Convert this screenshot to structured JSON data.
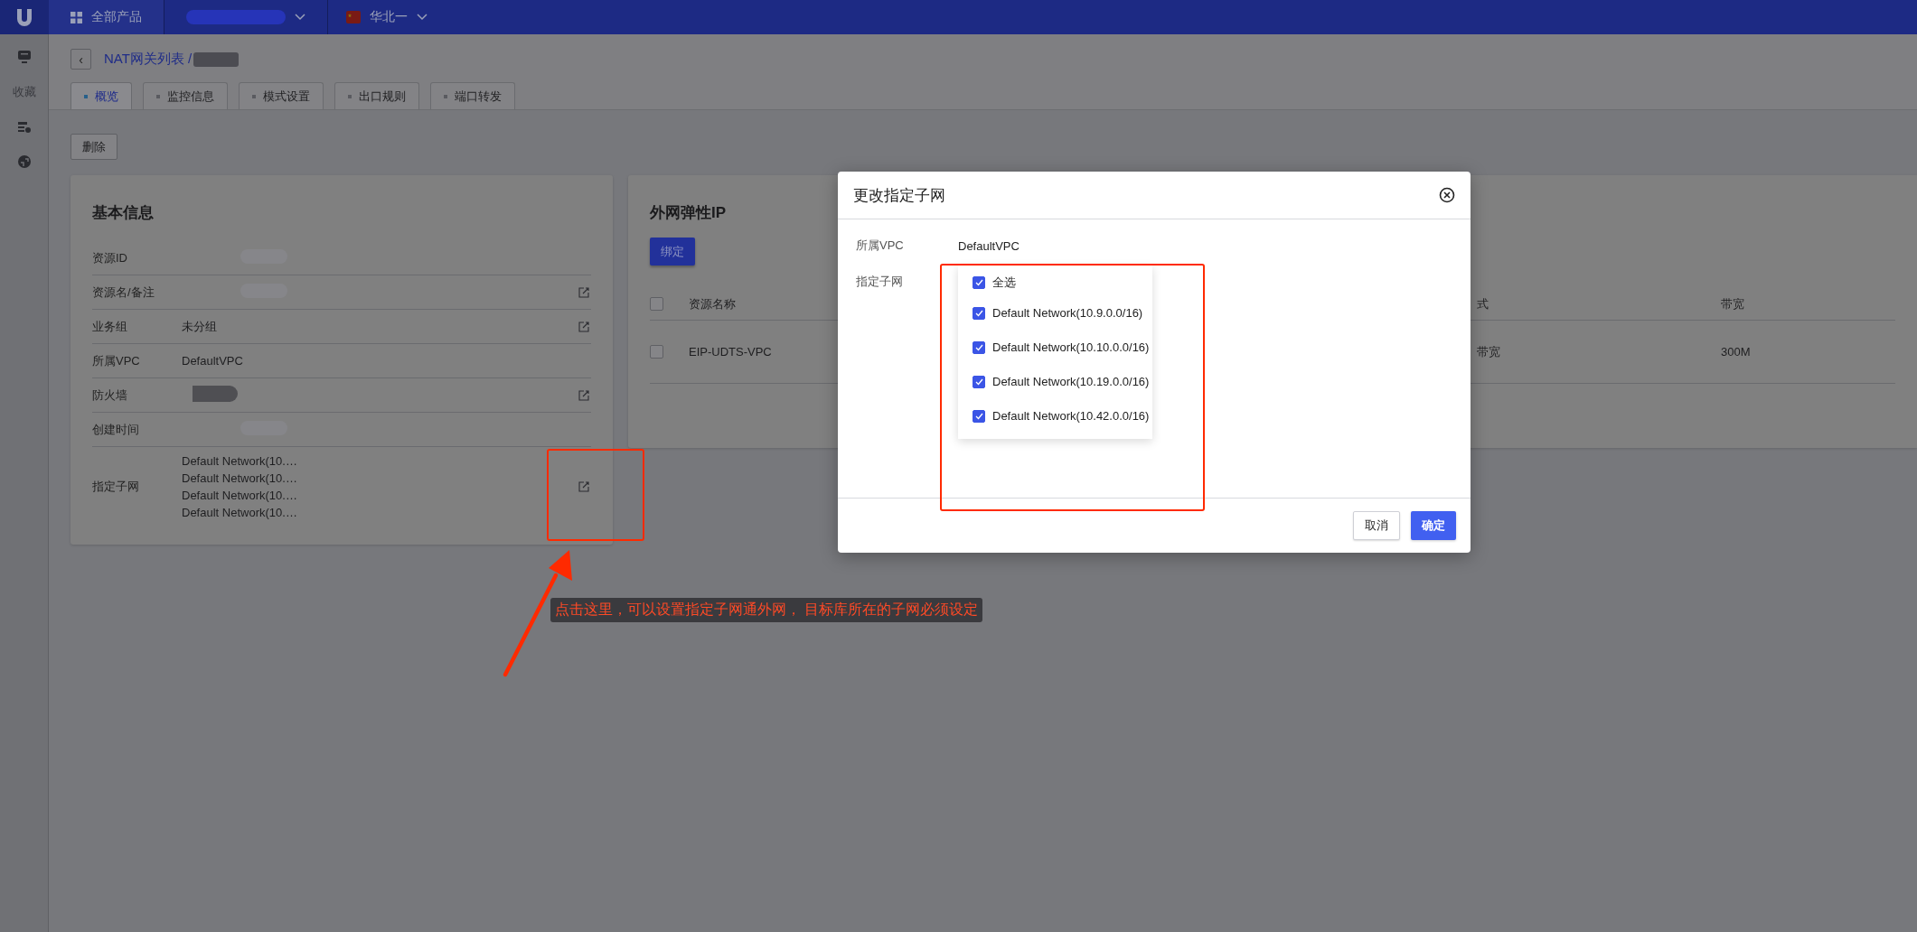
{
  "top_bar": {
    "products_label": "全部产品",
    "region": "华北一"
  },
  "sidebar": {
    "favorites_label": "收藏"
  },
  "breadcrumb": {
    "back": "‹",
    "title": "NAT网关列表 /"
  },
  "tabs": [
    {
      "label": "概览",
      "selected": true
    },
    {
      "label": "监控信息",
      "selected": false
    },
    {
      "label": "模式设置",
      "selected": false
    },
    {
      "label": "出口规则",
      "selected": false
    },
    {
      "label": "端口转发",
      "selected": false
    }
  ],
  "delete_button": "删除",
  "basic_info": {
    "title": "基本信息",
    "rows": [
      {
        "kind": "redacted",
        "label": "资源ID",
        "editable": false
      },
      {
        "kind": "redacted",
        "label": "资源名/备注",
        "editable": true
      },
      {
        "kind": "text",
        "label": "业务组",
        "value": "未分组",
        "editable": true
      },
      {
        "kind": "text",
        "label": "所属VPC",
        "value": "DefaultVPC",
        "editable": false
      },
      {
        "kind": "redacted_dark",
        "label": "防火墙",
        "editable": true
      },
      {
        "kind": "redacted",
        "label": "创建时间",
        "editable": false
      },
      {
        "kind": "list",
        "label": "指定子网",
        "values": [
          "Default Network(10.…",
          "Default Network(10.…",
          "Default Network(10.…",
          "Default Network(10.…"
        ],
        "editable": true
      }
    ]
  },
  "eip_card": {
    "title": "外网弹性IP",
    "bind_button": "绑定",
    "header_checked": false,
    "columns": [
      "资源名称",
      "式",
      "带宽"
    ],
    "rows": [
      {
        "checked": false,
        "cells": [
          "EIP-UDTS-VPC",
          "带宽",
          "300M"
        ]
      }
    ]
  },
  "dialog": {
    "title": "更改指定子网",
    "vpc_label": "所属VPC",
    "vpc_value": "DefaultVPC",
    "subnet_label": "指定子网",
    "options": [
      {
        "label": "全选",
        "checked": true
      },
      {
        "label": "Default Network(10.9.0.0/16)",
        "checked": true
      },
      {
        "label": "Default Network(10.10.0.0/16)",
        "checked": true
      },
      {
        "label": "Default Network(10.19.0.0/16)",
        "checked": true
      },
      {
        "label": "Default Network(10.42.0.0/16)",
        "checked": true
      }
    ],
    "cancel_button": "取消",
    "confirm_button": "确定"
  },
  "annotation": {
    "text": "点击这里，可以设置指定子网通外网， 目标库所在的子网必须设定"
  }
}
